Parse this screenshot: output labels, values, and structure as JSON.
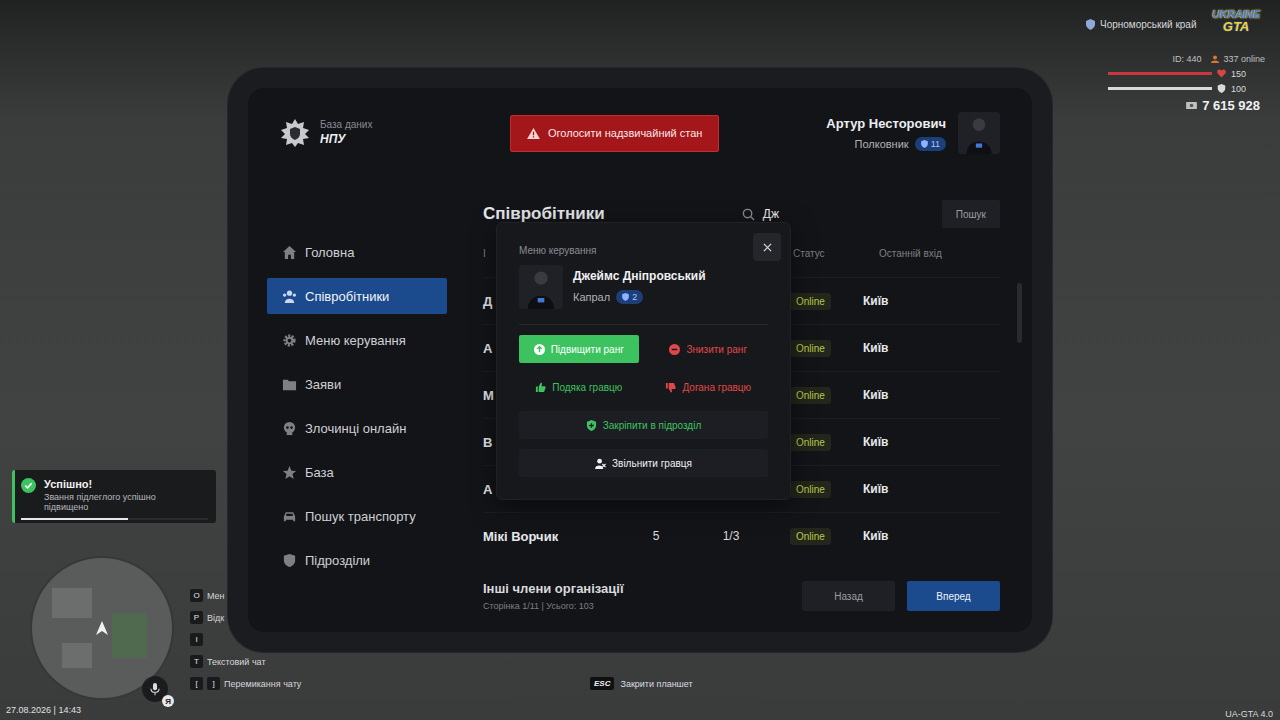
{
  "hud": {
    "region": "Чорноморський край",
    "logo": {
      "top": "UKRAINE",
      "bottom": "GTA"
    },
    "player_id": "ID: 440",
    "online": "337 online",
    "health": {
      "value": "150",
      "level": 1
    },
    "armor": {
      "value": "100",
      "level": 1
    },
    "money": "7 615 928",
    "datetime": "27.08.2026 | 14:43",
    "mic_badge": "Я",
    "close_hint": {
      "key": "ESC",
      "label": "Закрити планшет"
    },
    "version": "UA-GTA 4.0",
    "key_hints": [
      {
        "keys": [
          "O"
        ],
        "label": "Мен"
      },
      {
        "keys": [
          "P"
        ],
        "label": "Відк"
      },
      {
        "keys": [
          "I"
        ]
      },
      {
        "keys": [
          "T"
        ],
        "label": "Текстовий чат"
      },
      {
        "keys": [
          "[",
          "]"
        ],
        "label": "Перемикання чату"
      }
    ]
  },
  "notification": {
    "title": "Успішно!",
    "message": "Звання підлеглого успішно підвищено",
    "level": 0.57
  },
  "tablet": {
    "header": {
      "caption": "База даних",
      "org": "НПУ",
      "emergency_button": "Оголосити надзвичайний стан",
      "user": {
        "name": "Артур Несторович",
        "rank": "Полковник",
        "rank_level": "11"
      }
    },
    "sidebar": {
      "items": [
        {
          "label": "Головна",
          "kind": "home",
          "selected": false
        },
        {
          "label": "Співробітники",
          "kind": "staff",
          "selected": true
        },
        {
          "label": "Меню керування",
          "kind": "gear",
          "selected": false
        },
        {
          "label": "Заяви",
          "kind": "folder",
          "selected": false
        },
        {
          "label": "Злочинці онлайн",
          "kind": "criminals",
          "selected": false
        },
        {
          "label": "База",
          "kind": "star",
          "selected": false
        },
        {
          "label": "Пошук транспорту",
          "kind": "car",
          "selected": false
        },
        {
          "label": "Підрозділи",
          "kind": "shield",
          "selected": false
        }
      ]
    },
    "employees": {
      "title": "Співробітники",
      "search": {
        "value": "Дж"
      },
      "search_button": "Пошук",
      "columns": [
        {
          "label": "І"
        },
        {
          "label": "Статус"
        },
        {
          "label": "Останній вхід"
        }
      ],
      "rows": [
        {
          "name": "Д",
          "status": "Online",
          "last_seen": "Київ"
        },
        {
          "name": "А",
          "status": "Online",
          "last_seen": "Київ"
        },
        {
          "name": "М",
          "status": "Online",
          "last_seen": "Київ"
        },
        {
          "name": "В",
          "status": "Online",
          "last_seen": "Київ"
        },
        {
          "name": "А",
          "status": "Online",
          "last_seen": "Київ"
        },
        {
          "name": "Мікі Ворчик",
          "rank": "5",
          "warnings": "1/3",
          "status": "Online",
          "last_seen": "Київ"
        }
      ],
      "footer": {
        "title": "Інші члени організації",
        "page_info": "Сторінка 1/11 | Усього: 103"
      },
      "pagination": [
        {
          "label": "Назад",
          "primary": false
        },
        {
          "label": "Вперед",
          "primary": true
        }
      ]
    },
    "modal": {
      "title": "Меню керування",
      "player": {
        "name": "Джеймс Дніпровський",
        "rank": "Капрал",
        "rank_level": "2"
      },
      "actions": [
        {
          "label": "Підвищити ранг",
          "kind": "promote",
          "color": "#3cc35f",
          "hovered": true
        },
        {
          "label": "Знизити ранг",
          "kind": "demote",
          "color": "#e04848",
          "hovered": false
        },
        {
          "label": "Подяка гравцю",
          "kind": "thank",
          "color": "#3cc35f",
          "hovered": false
        },
        {
          "label": "Догана гравцю",
          "kind": "reprimand",
          "color": "#e04848",
          "hovered": false
        },
        {
          "label": "Закріпити в підрозділ",
          "kind": "assign",
          "color": "#3cc35f",
          "hovered": false
        },
        {
          "label": "Звільнити гравця",
          "kind": "dismiss",
          "color": "#f2f2f4",
          "hovered": false
        }
      ]
    }
  }
}
